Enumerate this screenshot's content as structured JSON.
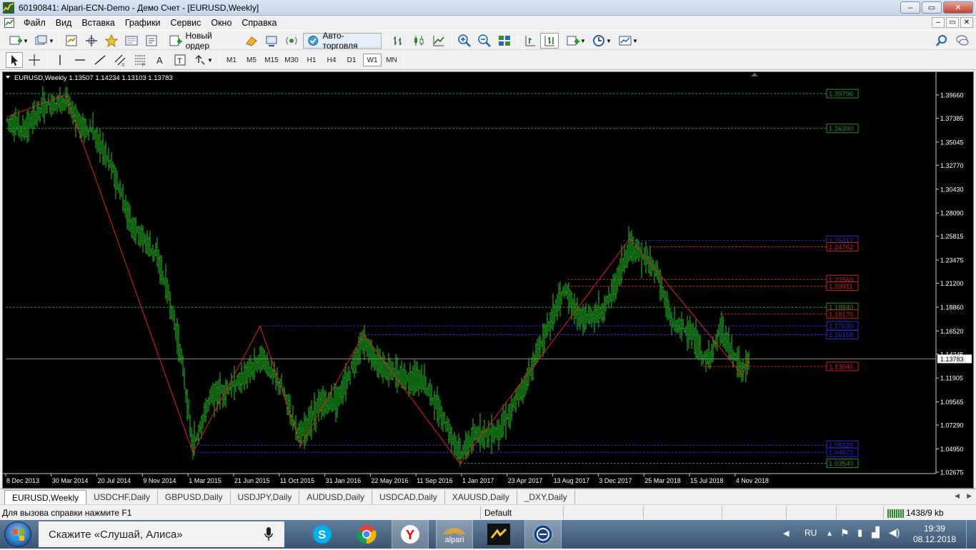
{
  "window": {
    "title": "60190841: Alpari-ECN-Demo - Демо Счет - [EURUSD,Weekly]",
    "buttons": {
      "minimize": "–",
      "maximize": "▭",
      "close": "✕"
    }
  },
  "menu": {
    "items": [
      "Файл",
      "Вид",
      "Вставка",
      "Графики",
      "Сервис",
      "Окно",
      "Справка"
    ],
    "mdi_buttons": {
      "minimize": "–",
      "restore": "▭",
      "close": "✕"
    }
  },
  "toolbar": {
    "new_order_label": "Новый ордер",
    "autotrading_label": "Авто-торговля"
  },
  "timeframes": {
    "items": [
      "M1",
      "M5",
      "M15",
      "M30",
      "H1",
      "H4",
      "D1",
      "W1",
      "MN"
    ],
    "active": "W1"
  },
  "chart": {
    "header": "EURUSD,Weekly  1.13507 1.14234 1.13103 1.13783",
    "current_price": "1.13783",
    "price_ticks": [
      "1.39660",
      "1.37385",
      "1.35045",
      "1.32770",
      "1.30430",
      "1.28090",
      "1.25815",
      "1.23475",
      "1.21200",
      "1.18860",
      "1.16520",
      "1.14245",
      "1.11905",
      "1.09565",
      "1.07290",
      "1.04950",
      "1.02675"
    ],
    "date_ticks": [
      "8 Dec 2013",
      "30 Mar 2014",
      "20 Jul 2014",
      "9 Nov 2014",
      "1 Mar 2015",
      "21 Jun 2015",
      "11 Oct 2015",
      "31 Jan 2016",
      "22 May 2016",
      "11 Sep 2016",
      "1 Jan 2017",
      "23 Apr 2017",
      "13 Aug 2017",
      "3 Dec 2017",
      "25 Mar 2018",
      "15 Jul 2018",
      "4 Nov 2018"
    ],
    "levels": [
      {
        "label": "1.39796",
        "color": "#2e8b2e"
      },
      {
        "label": "1.36390",
        "color": "#2e8b2e"
      },
      {
        "label": "1.25417",
        "color": "#2a2acc"
      },
      {
        "label": "1.24762",
        "color": "#cc2222"
      },
      {
        "label": "1.21569",
        "color": "#cc2222"
      },
      {
        "label": "1.20911",
        "color": "#cc2222"
      },
      {
        "label": "1.18840",
        "color": "#2e8b2e"
      },
      {
        "label": "1.18170",
        "color": "#cc2222"
      },
      {
        "label": "1.17030",
        "color": "#2a2acc"
      },
      {
        "label": "1.16158",
        "color": "#2a2acc"
      },
      {
        "label": "1.13046",
        "color": "#cc2222"
      },
      {
        "label": "1.05320",
        "color": "#2a2acc"
      },
      {
        "label": "1.04622",
        "color": "#2a2acc"
      },
      {
        "label": "1.03540",
        "color": "#2e8b2e"
      }
    ]
  },
  "tabs": {
    "items": [
      "EURUSD,Weekly",
      "USDCHF,Daily",
      "GBPUSD,Daily",
      "USDJPY,Daily",
      "AUDUSD,Daily",
      "USDCAD,Daily",
      "XAUUSD,Daily",
      "_DXY,Daily"
    ],
    "active": "EURUSD,Weekly"
  },
  "status": {
    "help": "Для вызова справки нажмите F1",
    "profile": "Default",
    "traffic": "1438/9 kb"
  },
  "taskbar": {
    "search_text": "Скажите «Слушай, Алиса»",
    "alpari_label": "alpari",
    "language": "RU",
    "time": "19:39",
    "date": "08.12.2018"
  }
}
